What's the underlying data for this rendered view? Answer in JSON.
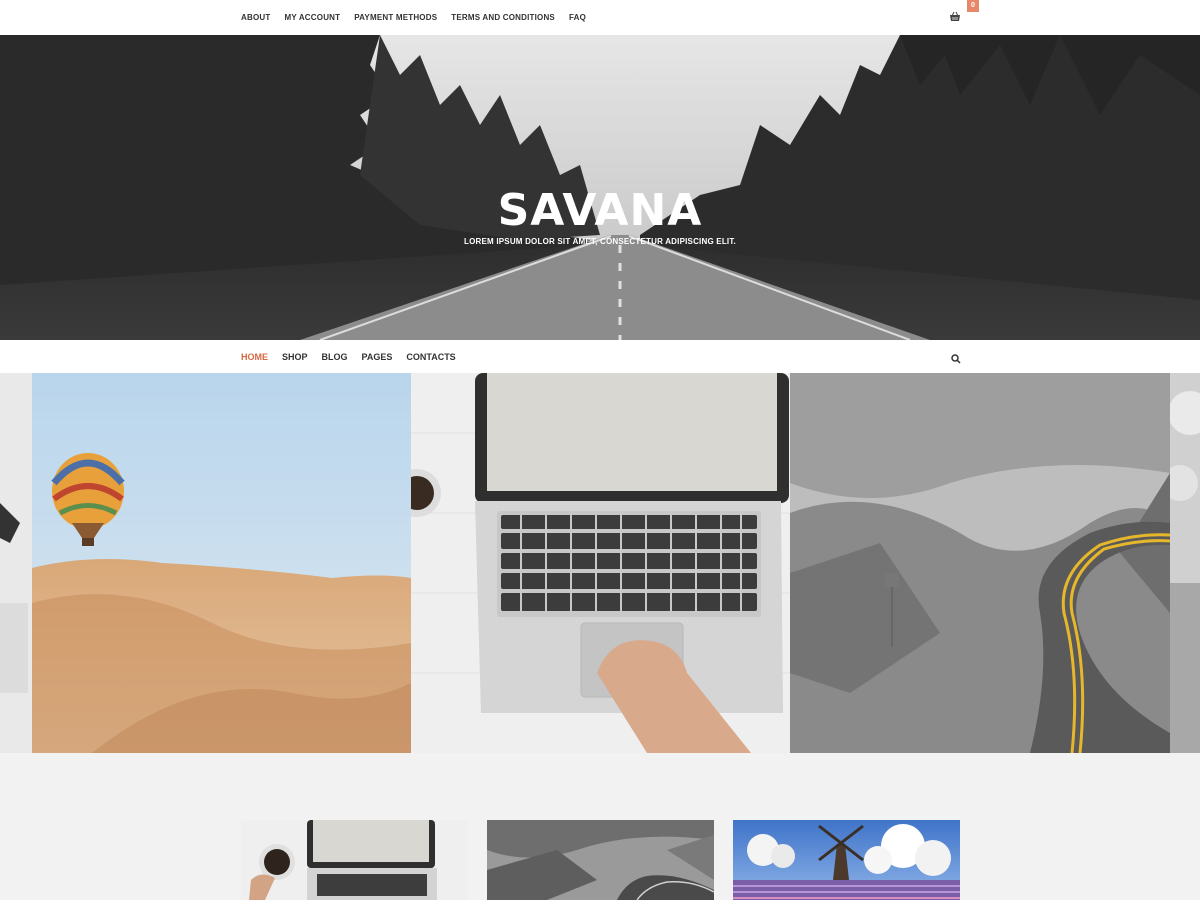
{
  "top_nav": {
    "items": [
      "ABOUT",
      "MY ACCOUNT",
      "PAYMENT METHODS",
      "TERMS AND CONDITIONS",
      "FAQ"
    ],
    "cart_icon": "basket-icon",
    "cart_count": "0"
  },
  "hero": {
    "title": "SAVANA",
    "subtitle": "LOREM IPSUM DOLOR SIT AMET, CONSECTETUR ADIPISCING ELIT."
  },
  "main_nav": {
    "items": [
      "HOME",
      "SHOP",
      "BLOG",
      "PAGES",
      "CONTACTS"
    ],
    "active": "HOME",
    "search_icon": "search-icon"
  },
  "colors": {
    "accent": "#d46a43",
    "badge": "#e8886a",
    "page_bg": "#f2f2f2",
    "bar_bg": "#ffffff"
  }
}
